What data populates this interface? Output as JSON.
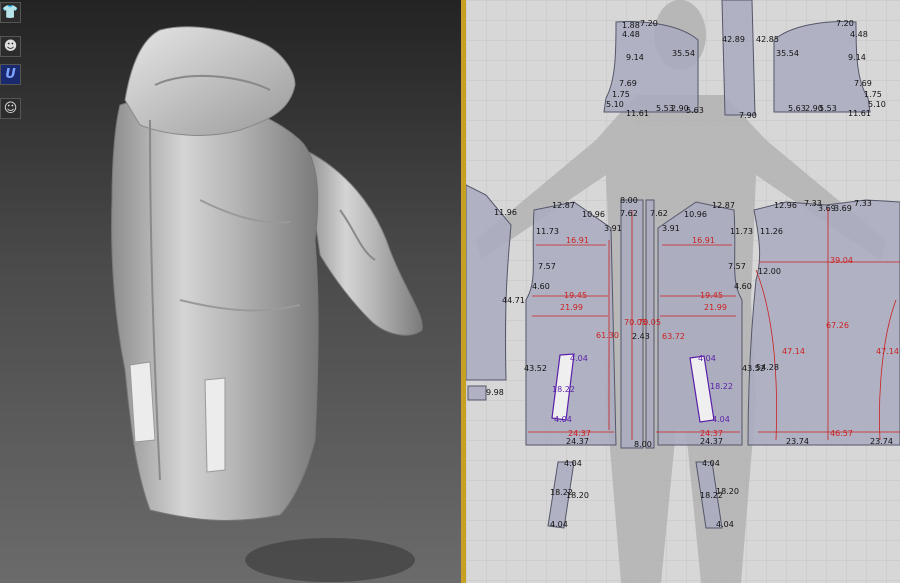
{
  "toolbar": {
    "tools": [
      {
        "name": "tshirt-icon",
        "glyph": "👕"
      },
      {
        "name": "avatar-head-icon",
        "glyph": "☻"
      },
      {
        "name": "u-tool-icon",
        "glyph": "U"
      },
      {
        "name": "avatar-face-icon",
        "glyph": "☺"
      }
    ]
  },
  "colors": {
    "panel_fill": "#a9abc0",
    "panel_stroke": "#55566a",
    "grid_line": "#c4c4c4",
    "highlight": "#c8a021",
    "measure_red": "#cc1f1f",
    "measure_purple": "#5a1fa8"
  },
  "pattern": {
    "top_left": {
      "m1": "1.88",
      "m2": "7.20",
      "m3": "4.48",
      "m4": "9.14",
      "m5": "7.69",
      "m6": "1.75",
      "m7": "5.10",
      "m8": "11.61",
      "m9": "5.53",
      "m10": "2.90",
      "m11": "5.63",
      "m12": "35.54"
    },
    "sleeve_strip": {
      "top": "42.89",
      "bottom": "7.90"
    },
    "top_right": {
      "m1": "42.85",
      "m2": "7.20",
      "m3": "4.48",
      "m4": "35.54",
      "m5": "9.14",
      "m6": "7.69",
      "m7": "1.75",
      "m8": "5.10",
      "m9": "5.63",
      "m10": "2.90",
      "m11": "5.53",
      "m12": "11.61"
    },
    "left_edge": {
      "m1": "11.96",
      "m2": "44.71",
      "m3": "9.98"
    },
    "front_left": {
      "m1": "12.87",
      "m2": "10.96",
      "m3": "3.91",
      "m4": "11.73",
      "m5": "16.91",
      "m6": "7.57",
      "m7": "4.60",
      "m8": "19.45",
      "m9": "21.99",
      "m10": "61.30",
      "m11": "43.52",
      "m12": "18.22",
      "m13": "4.04",
      "m14": "4.04",
      "m15": "24.37",
      "m16": "24.37"
    },
    "zip_strip_left": {
      "m1": "8.00",
      "m2": "7.62",
      "m3": "70.05",
      "m4": "2.43",
      "m5": "8.00"
    },
    "zip_strip_right": {
      "m1": "7.62",
      "m2": "70.05",
      "m3": "63.72"
    },
    "front_right": {
      "m1": "10.96",
      "m2": "12.87",
      "m3": "3.91",
      "m4": "11.73",
      "m5": "16.91",
      "m6": "7.57",
      "m7": "4.60",
      "m8": "19.45",
      "m9": "21.99",
      "m10": "4.04",
      "m11": "18.22",
      "m12": "4.04",
      "m13": "43.52",
      "m14": "24.37",
      "m15": "24.37"
    },
    "back": {
      "m1": "12.96",
      "m2": "7.33",
      "m3": "3.69",
      "m4": "3.69",
      "m5": "7.33",
      "m6": "11.26",
      "m7": "12.00",
      "m8": "39.04",
      "m9": "67.26",
      "m10": "47.14",
      "m11": "47.14",
      "m12": "54.28",
      "m13": "46.57",
      "m14": "23.74",
      "m15": "23.74"
    },
    "pocket_left": {
      "m1": "4.04",
      "m2": "18.22",
      "m3": "18.20",
      "m4": "4.04"
    },
    "pocket_right": {
      "m1": "4.04",
      "m2": "18.22",
      "m3": "18.20",
      "m4": "4.04"
    }
  }
}
